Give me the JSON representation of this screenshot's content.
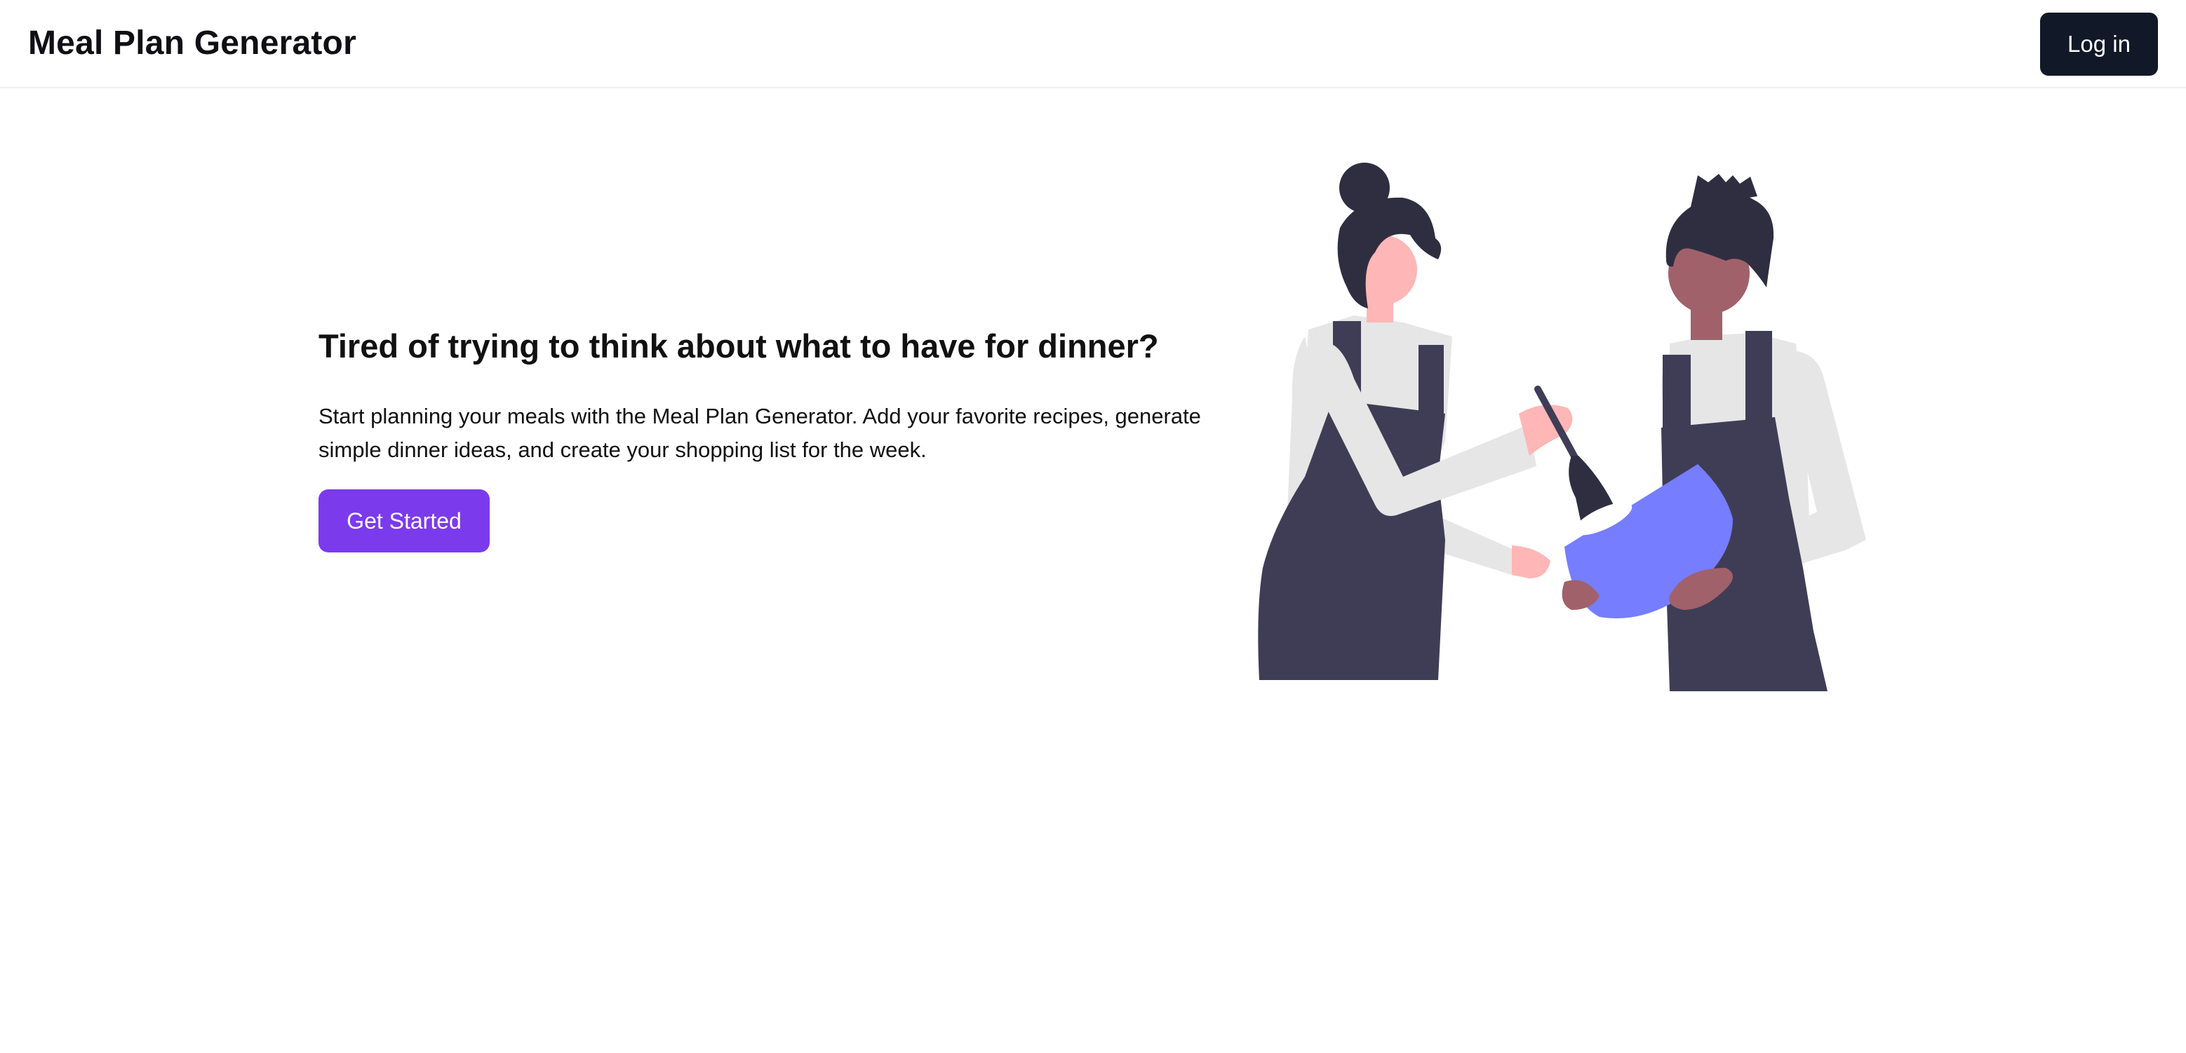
{
  "header": {
    "app_title": "Meal Plan Generator",
    "login_label": "Log in"
  },
  "hero": {
    "heading": "Tired of trying to think about what to have for dinner?",
    "description": "Start planning your meals with the Meal Plan Generator. Add your favorite recipes, generate simple dinner ideas, and create your shopping list for the week.",
    "cta_label": "Get Started"
  },
  "colors": {
    "nav_button_bg": "#111827",
    "cta_bg": "#7c3aed",
    "illustration_hair": "#2f2e41",
    "illustration_apron": "#3f3d56",
    "illustration_shirt": "#e6e6e6",
    "illustration_skin_light": "#ffb6b6",
    "illustration_skin_dark": "#a0616a",
    "illustration_bowl": "#767dff"
  },
  "illustration": {
    "name": "two-people-cooking-illustration"
  }
}
